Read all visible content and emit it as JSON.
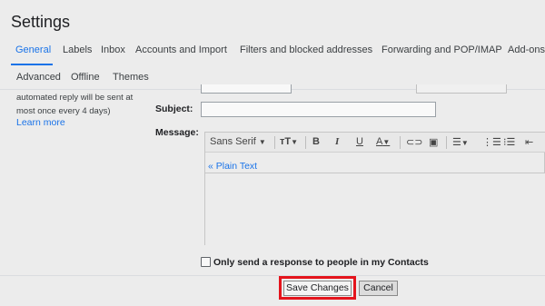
{
  "page": {
    "title": "Settings"
  },
  "tabs": {
    "row1": [
      "General",
      "Labels",
      "Inbox",
      "Accounts and Import",
      "Filters and blocked addresses",
      "Forwarding and POP/IMAP",
      "Add-ons"
    ],
    "row2": [
      "Advanced",
      "Offline",
      "Themes"
    ],
    "active": "General"
  },
  "vacation": {
    "note_line1": "automated reply will be sent at",
    "note_line2": "most once every 4 days)",
    "learn_more": "Learn more",
    "subject_label": "Subject:",
    "message_label": "Message:",
    "subject_value": "",
    "font_name": "Sans Serif",
    "plain_text_link": "« Plain Text",
    "contacts_only_label": "Only send a response to people in my Contacts",
    "contacts_only_checked": false
  },
  "toolbar_icons": [
    "font-dropdown",
    "text-size-icon",
    "bold-icon",
    "italic-icon",
    "underline-icon",
    "text-color-icon",
    "link-icon",
    "image-icon",
    "align-icon",
    "numbered-list-icon",
    "bulleted-list-icon",
    "indent-less-icon"
  ],
  "actions": {
    "save_label": "Save Changes",
    "cancel_label": "Cancel"
  },
  "colors": {
    "accent": "#1a73e8",
    "highlight": "#e4141c"
  }
}
